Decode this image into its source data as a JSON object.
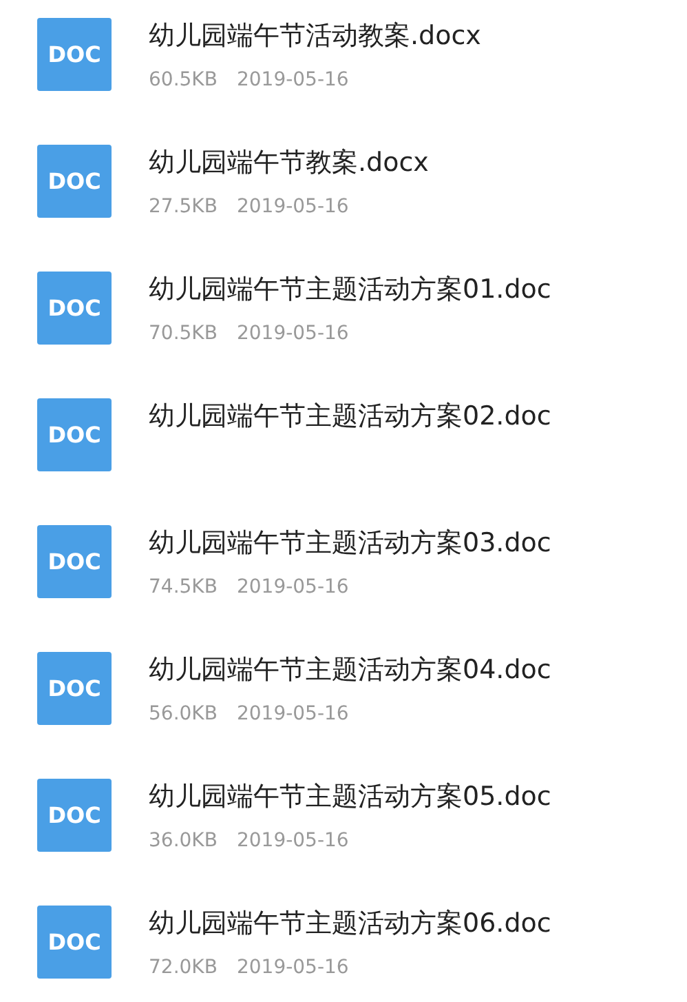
{
  "files": [
    {
      "icon": "DOC",
      "name": "幼儿园端午节活动教案.docx",
      "size": "60.5KB",
      "date": "2019-05-16"
    },
    {
      "icon": "DOC",
      "name": "幼儿园端午节教案.docx",
      "size": "27.5KB",
      "date": "2019-05-16"
    },
    {
      "icon": "DOC",
      "name": "幼儿园端午节主题活动方案01.doc",
      "size": "70.5KB",
      "date": "2019-05-16"
    },
    {
      "icon": "DOC",
      "name": "幼儿园端午节主题活动方案02.doc"
    },
    {
      "icon": "DOC",
      "name": "幼儿园端午节主题活动方案03.doc",
      "size": "74.5KB",
      "date": "2019-05-16"
    },
    {
      "icon": "DOC",
      "name": "幼儿园端午节主题活动方案04.doc",
      "size": "56.0KB",
      "date": "2019-05-16"
    },
    {
      "icon": "DOC",
      "name": "幼儿园端午节主题活动方案05.doc",
      "size": "36.0KB",
      "date": "2019-05-16"
    },
    {
      "icon": "DOC",
      "name": "幼儿园端午节主题活动方案06.doc",
      "size": "72.0KB",
      "date": "2019-05-16"
    }
  ]
}
